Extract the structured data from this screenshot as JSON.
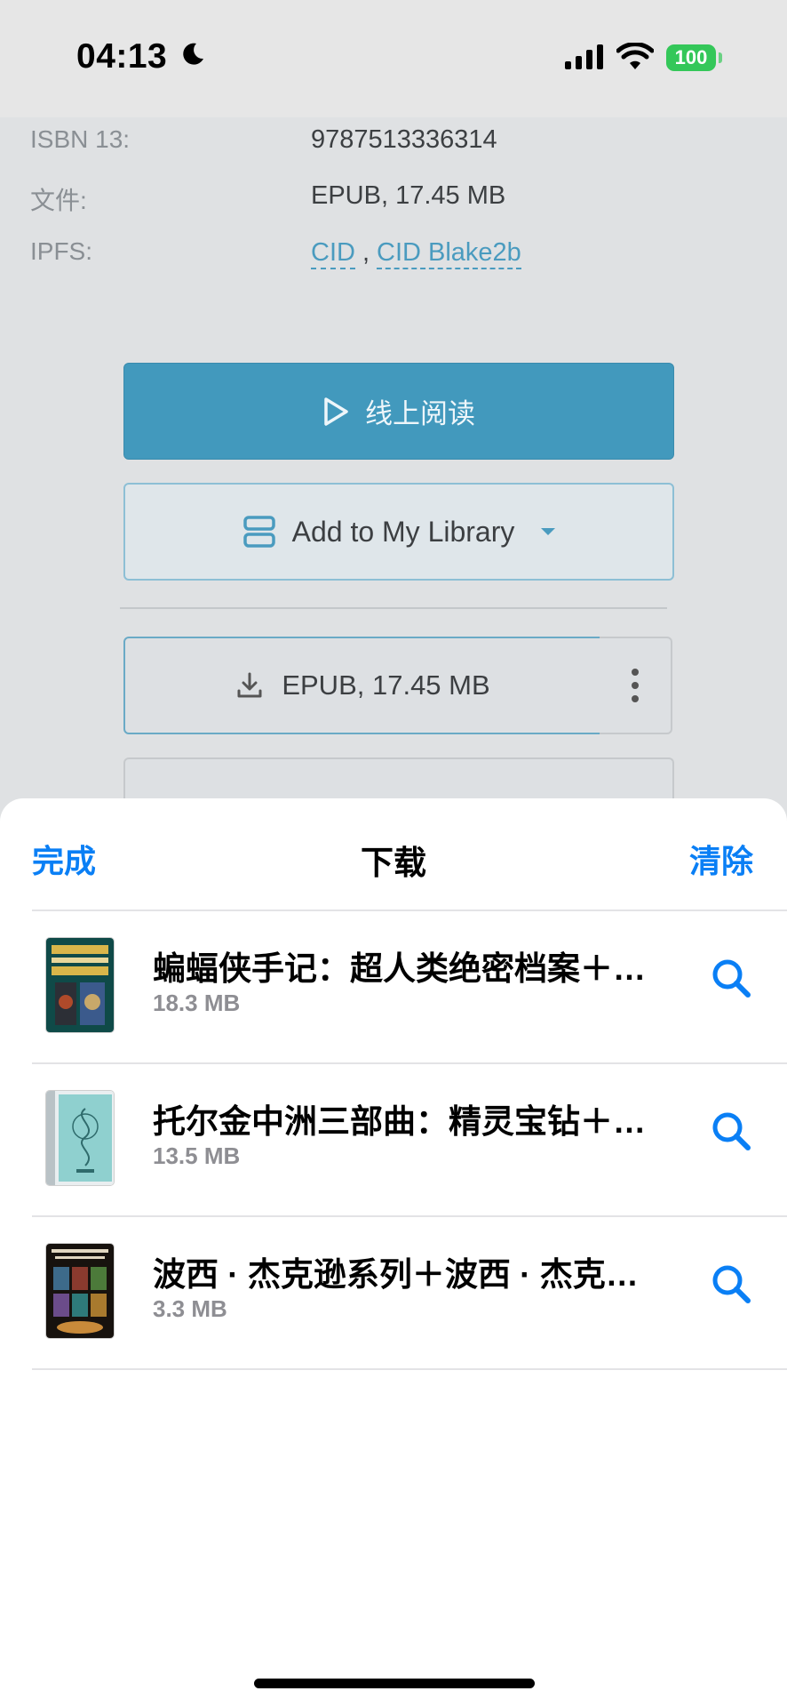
{
  "status_bar": {
    "time": "04:13",
    "battery": "100"
  },
  "book_meta": [
    {
      "label": "ISBN 13:",
      "value": "9787513336314"
    },
    {
      "label": "文件:",
      "value": "EPUB, 17.45 MB"
    },
    {
      "label": "IPFS:",
      "links": [
        "CID",
        "CID Blake2b"
      ],
      "separator": ","
    }
  ],
  "actions": {
    "read_online": "线上阅读",
    "add_to_library": "Add to My Library",
    "download": "EPUB, 17.45 MB"
  },
  "sheet": {
    "done": "完成",
    "title": "下载",
    "clear": "清除",
    "items": [
      {
        "title": "蝙蝠侠手记：超人类绝密档案＋…",
        "size": "18.3 MB"
      },
      {
        "title": "托尔金中洲三部曲：精灵宝钻＋…",
        "size": "13.5 MB"
      },
      {
        "title": "波西 · 杰克逊系列＋波西 · 杰克…",
        "size": "3.3 MB"
      }
    ]
  },
  "colors": {
    "accent": "#0a7ff5",
    "primary_button": "#4299bd",
    "link": "#4a9bbf",
    "battery": "#34c759"
  }
}
